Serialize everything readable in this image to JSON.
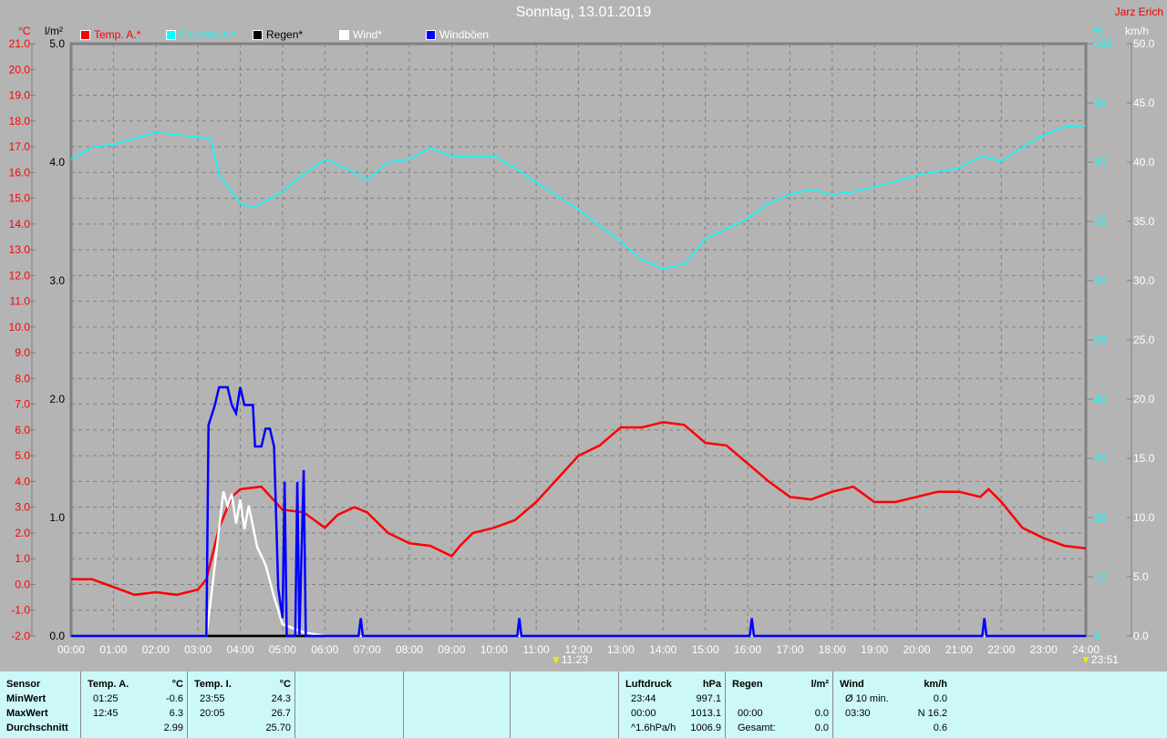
{
  "title": "Sonntag, 13.01.2019",
  "author": "Jarz Erich",
  "units": {
    "temp": "°C",
    "rain": "l/m²",
    "humidity": "%",
    "wind": "km/h"
  },
  "legend": [
    {
      "label": "Temp. A.*",
      "color": "#ff0000"
    },
    {
      "label": "Feuchte A.*",
      "color": "#00ffff"
    },
    {
      "label": "Regen*",
      "color": "#000000"
    },
    {
      "label": "Wind*",
      "color": "#ffffff"
    },
    {
      "label": "Windböen",
      "color": "#0000ff"
    }
  ],
  "markers": [
    {
      "label": "11:23"
    },
    {
      "label": "23:51"
    }
  ],
  "chart_data": {
    "type": "line",
    "title": "Sonntag, 13.01.2019",
    "x_unit": "hour",
    "x_ticks": [
      "00:00",
      "01:00",
      "02:00",
      "03:00",
      "04:00",
      "05:00",
      "06:00",
      "07:00",
      "08:00",
      "09:00",
      "10:00",
      "11:00",
      "12:00",
      "13:00",
      "14:00",
      "15:00",
      "16:00",
      "17:00",
      "18:00",
      "19:00",
      "20:00",
      "21:00",
      "22:00",
      "23:00",
      "24:00"
    ],
    "axes": {
      "temp": {
        "label": "°C",
        "range": [
          -2,
          21
        ],
        "ticks": [
          "21.0",
          "20.0",
          "19.0",
          "18.0",
          "17.0",
          "16.0",
          "15.0",
          "14.0",
          "13.0",
          "12.0",
          "11.0",
          "10.0",
          "9.0",
          "8.0",
          "7.0",
          "6.0",
          "5.0",
          "4.0",
          "3.0",
          "2.0",
          "1.0",
          "0.0",
          "-1.0",
          "-2.0"
        ]
      },
      "rain": {
        "label": "l/m²",
        "range": [
          0,
          5
        ],
        "ticks": [
          "5.0",
          "4.0",
          "3.0",
          "2.0",
          "1.0",
          "0.0"
        ]
      },
      "humidity": {
        "label": "%",
        "range": [
          0,
          100
        ],
        "ticks": [
          "100",
          "90",
          "80",
          "70",
          "60",
          "50",
          "40",
          "30",
          "20",
          "10",
          "0"
        ]
      },
      "wind": {
        "label": "km/h",
        "range": [
          0,
          50
        ],
        "ticks": [
          "50.0",
          "45.0",
          "40.0",
          "35.0",
          "30.0",
          "25.0",
          "20.0",
          "15.0",
          "10.0",
          "5.0",
          "0.0"
        ]
      }
    },
    "series": [
      {
        "name": "Feuchte A.",
        "axis": "humidity",
        "color": "#00ffff",
        "points": [
          [
            0,
            80.5
          ],
          [
            0.5,
            82.5
          ],
          [
            1,
            83
          ],
          [
            2,
            85
          ],
          [
            3,
            84.3
          ],
          [
            3.3,
            84
          ],
          [
            3.5,
            78
          ],
          [
            4,
            73
          ],
          [
            4.3,
            72.3
          ],
          [
            5,
            75
          ],
          [
            5.5,
            78
          ],
          [
            6,
            80.5
          ],
          [
            6.5,
            79
          ],
          [
            7,
            77
          ],
          [
            7.5,
            80
          ],
          [
            8,
            80.5
          ],
          [
            8.5,
            82.5
          ],
          [
            9,
            81
          ],
          [
            10,
            81
          ],
          [
            10.5,
            79
          ],
          [
            11,
            76.6
          ],
          [
            12,
            72
          ],
          [
            13,
            66.6
          ],
          [
            13.5,
            63.5
          ],
          [
            14,
            62
          ],
          [
            14.5,
            62.8
          ],
          [
            15,
            67
          ],
          [
            16,
            70.5
          ],
          [
            16.5,
            73
          ],
          [
            17,
            74.6
          ],
          [
            17.5,
            75.4
          ],
          [
            18,
            74.6
          ],
          [
            18.5,
            75
          ],
          [
            19,
            75.8
          ],
          [
            20,
            77.8
          ],
          [
            21,
            79
          ],
          [
            21.5,
            81
          ],
          [
            22,
            80.2
          ],
          [
            22.5,
            82.5
          ],
          [
            23,
            84.6
          ],
          [
            23.5,
            86
          ],
          [
            24,
            86.2
          ]
        ]
      },
      {
        "name": "Temp. A.",
        "axis": "temp",
        "color": "#ff0000",
        "points": [
          [
            0,
            0.2
          ],
          [
            0.5,
            0.2
          ],
          [
            1,
            -0.1
          ],
          [
            1.5,
            -0.4
          ],
          [
            2,
            -0.3
          ],
          [
            2.5,
            -0.4
          ],
          [
            3,
            -0.2
          ],
          [
            3.2,
            0.2
          ],
          [
            3.5,
            2.2
          ],
          [
            3.8,
            3.4
          ],
          [
            4,
            3.7
          ],
          [
            4.5,
            3.8
          ],
          [
            5,
            2.9
          ],
          [
            5.5,
            2.8
          ],
          [
            6,
            2.2
          ],
          [
            6.3,
            2.7
          ],
          [
            6.7,
            3.0
          ],
          [
            7,
            2.8
          ],
          [
            7.5,
            2.0
          ],
          [
            8,
            1.6
          ],
          [
            8.5,
            1.5
          ],
          [
            9,
            1.1
          ],
          [
            9.2,
            1.5
          ],
          [
            9.5,
            2.0
          ],
          [
            10,
            2.2
          ],
          [
            10.5,
            2.5
          ],
          [
            11,
            3.2
          ],
          [
            11.5,
            4.1
          ],
          [
            12,
            5.0
          ],
          [
            12.5,
            5.4
          ],
          [
            13,
            6.1
          ],
          [
            13.5,
            6.1
          ],
          [
            14,
            6.3
          ],
          [
            14.5,
            6.2
          ],
          [
            15,
            5.5
          ],
          [
            15.5,
            5.4
          ],
          [
            16,
            4.7
          ],
          [
            16.5,
            4.0
          ],
          [
            17,
            3.4
          ],
          [
            17.5,
            3.3
          ],
          [
            18,
            3.6
          ],
          [
            18.5,
            3.8
          ],
          [
            19,
            3.2
          ],
          [
            19.5,
            3.2
          ],
          [
            20,
            3.4
          ],
          [
            20.5,
            3.6
          ],
          [
            21,
            3.6
          ],
          [
            21.5,
            3.4
          ],
          [
            21.7,
            3.7
          ],
          [
            22,
            3.2
          ],
          [
            22.5,
            2.2
          ],
          [
            23,
            1.8
          ],
          [
            23.5,
            1.5
          ],
          [
            24,
            1.4
          ]
        ]
      },
      {
        "name": "Regen",
        "axis": "rain",
        "color": "#000000",
        "points": [
          [
            0,
            0
          ],
          [
            24,
            0
          ]
        ]
      },
      {
        "name": "Wind",
        "axis": "wind",
        "color": "#ffffff",
        "points": [
          [
            0,
            0
          ],
          [
            3.2,
            0
          ],
          [
            3.4,
            6
          ],
          [
            3.6,
            12.2
          ],
          [
            3.7,
            11
          ],
          [
            3.8,
            12
          ],
          [
            3.9,
            9.5
          ],
          [
            4.0,
            11.5
          ],
          [
            4.1,
            9
          ],
          [
            4.2,
            11
          ],
          [
            4.4,
            7.5
          ],
          [
            4.6,
            6
          ],
          [
            4.8,
            3.3
          ],
          [
            5,
            1
          ],
          [
            5.5,
            0.3
          ],
          [
            6,
            0
          ],
          [
            24,
            0
          ]
        ]
      },
      {
        "name": "Windböen",
        "axis": "wind",
        "color": "#0000ff",
        "points": [
          [
            0,
            0
          ],
          [
            3.2,
            0
          ],
          [
            3.25,
            17.8
          ],
          [
            3.4,
            19.5
          ],
          [
            3.5,
            21
          ],
          [
            3.7,
            21
          ],
          [
            3.8,
            19.5
          ],
          [
            3.9,
            18.8
          ],
          [
            4.0,
            21
          ],
          [
            4.1,
            19.5
          ],
          [
            4.3,
            19.5
          ],
          [
            4.35,
            16
          ],
          [
            4.5,
            16
          ],
          [
            4.6,
            17.5
          ],
          [
            4.7,
            17.5
          ],
          [
            4.8,
            16
          ],
          [
            4.9,
            4
          ],
          [
            5.0,
            1.5
          ],
          [
            5.05,
            13
          ],
          [
            5.1,
            0
          ],
          [
            5.3,
            0
          ],
          [
            5.35,
            13
          ],
          [
            5.4,
            0
          ],
          [
            5.5,
            14
          ],
          [
            5.55,
            0
          ],
          [
            6.8,
            0
          ],
          [
            6.85,
            1.5
          ],
          [
            6.9,
            0
          ],
          [
            10.55,
            0
          ],
          [
            10.6,
            1.5
          ],
          [
            10.65,
            0
          ],
          [
            16.05,
            0
          ],
          [
            16.1,
            1.5
          ],
          [
            16.15,
            0
          ],
          [
            21.55,
            0
          ],
          [
            21.6,
            1.5
          ],
          [
            21.65,
            0
          ],
          [
            24,
            0
          ]
        ]
      }
    ]
  },
  "table": {
    "row_labels": [
      "Sensor",
      "MinWert",
      "MaxWert",
      "Durchschnitt"
    ],
    "columns": [
      {
        "title": "Temp. A.",
        "unit": "°C",
        "rows": [
          [
            "01:25",
            "-0.6"
          ],
          [
            "12:45",
            "6.3"
          ],
          [
            "",
            "2.99"
          ]
        ]
      },
      {
        "title": "Temp. I.",
        "unit": "°C",
        "rows": [
          [
            "23:55",
            "24.3"
          ],
          [
            "20:05",
            "26.7"
          ],
          [
            "",
            "25.70"
          ]
        ]
      },
      {
        "title": "Luftdruck",
        "unit": "hPa",
        "rows": [
          [
            "23:44",
            "997.1"
          ],
          [
            "00:00",
            "1013.1"
          ],
          [
            "^1.6hPa/h",
            "1006.9"
          ]
        ]
      },
      {
        "title": "Regen",
        "unit": "l/m²",
        "rows": [
          [
            "",
            ""
          ],
          [
            "00:00",
            "0.0"
          ],
          [
            "Gesamt:",
            "0.0"
          ]
        ]
      },
      {
        "title": "Wind",
        "unit": "km/h",
        "rows": [
          [
            "Ø 10 min.",
            "0.0"
          ],
          [
            "03:30",
            "N 16.2"
          ],
          [
            "",
            "0.6"
          ]
        ]
      }
    ]
  }
}
